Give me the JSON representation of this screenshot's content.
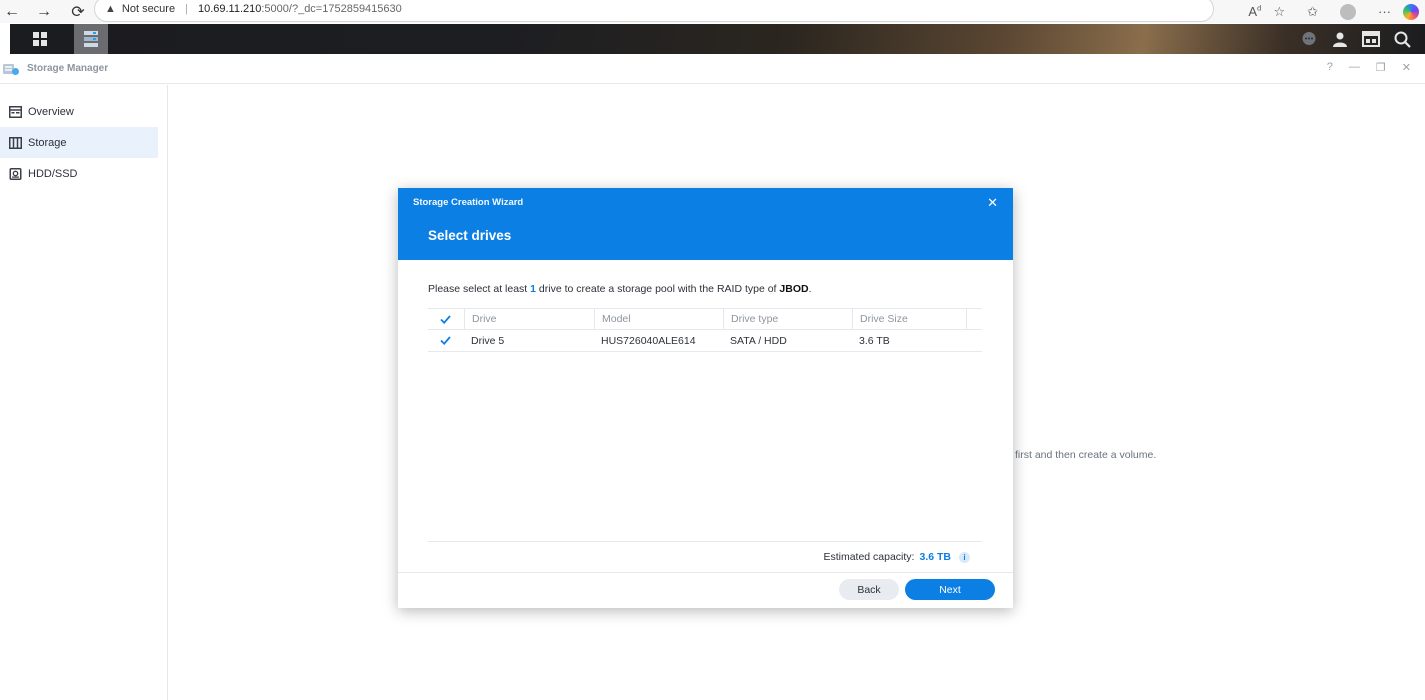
{
  "browser": {
    "security_label": "Not secure",
    "url_host": "10.69.11.210",
    "url_rest": ":5000/?_dc=1752859415630"
  },
  "window": {
    "title": "Storage Manager",
    "controls": [
      "?",
      "—",
      "❐",
      "✕"
    ]
  },
  "sidebar": {
    "items": [
      {
        "label": "Overview",
        "icon": "overview-icon"
      },
      {
        "label": "Storage",
        "icon": "storage-icon",
        "active": true
      },
      {
        "label": "HDD/SSD",
        "icon": "hdd-icon"
      }
    ]
  },
  "background_text": "first and then create a volume.",
  "wizard": {
    "header_title": "Storage Creation Wizard",
    "step_title": "Select drives",
    "instruction": {
      "prefix": "Please select at least",
      "count": "1",
      "middle": "drive to create a storage pool with the RAID type of",
      "raid_type": "JBOD",
      "suffix": "."
    },
    "table": {
      "headers": [
        "Drive",
        "Model",
        "Drive type",
        "Drive Size"
      ],
      "rows": [
        {
          "checked": true,
          "drive": "Drive 5",
          "model": "HUS726040ALE614",
          "type": "SATA / HDD",
          "size": "3.6 TB"
        }
      ]
    },
    "capacity": {
      "label": "Estimated capacity:",
      "value": "3.6 TB"
    },
    "buttons": {
      "back": "Back",
      "next": "Next"
    }
  },
  "colors": {
    "accent": "#0c7fe4",
    "border": "#e6e8eb"
  }
}
